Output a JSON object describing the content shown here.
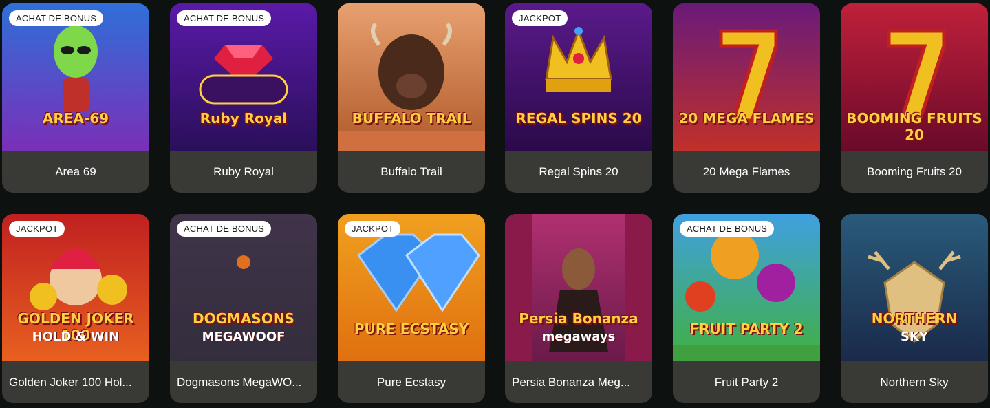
{
  "games": [
    {
      "title": "Area 69",
      "badge": "ACHAT DE BONUS",
      "logo": "AREA-69",
      "icon": "alien-icon",
      "colors": [
        "#2f6fd8",
        "#7a2fb8"
      ]
    },
    {
      "title": "Ruby Royal",
      "badge": "ACHAT DE BONUS",
      "logo": "Ruby Royal",
      "icon": "ruby-gem-icon",
      "colors": [
        "#5a1aa8",
        "#2a0f5a"
      ]
    },
    {
      "title": "Buffalo Trail",
      "badge": "",
      "logo": "BUFFALO TRAIL",
      "icon": "buffalo-icon",
      "colors": [
        "#e8a070",
        "#b05a2a"
      ]
    },
    {
      "title": "Regal Spins 20",
      "badge": "JACKPOT",
      "logo": "REGAL SPINS 20",
      "icon": "crown-icon",
      "colors": [
        "#5a1a8a",
        "#2a0a4a"
      ]
    },
    {
      "title": "20 Mega Flames",
      "badge": "",
      "logo": "20 MEGA FLAMES",
      "icon": "seven-icon",
      "colors": [
        "#6a1a7a",
        "#c0302a"
      ]
    },
    {
      "title": "Booming Fruits 20",
      "badge": "",
      "logo": "BOOMING FRUITS 20",
      "icon": "seven-icon",
      "colors": [
        "#c0203a",
        "#6a0a2a"
      ]
    },
    {
      "title": "Golden Joker 100 Hol...",
      "badge": "JACKPOT",
      "logo": "GOLDEN JOKER 100",
      "logo2": "HOLD & WIN",
      "icon": "joker-icon",
      "colors": [
        "#c02020",
        "#e86020"
      ]
    },
    {
      "title": "Dogmasons MegaWO...",
      "badge": "ACHAT DE BONUS",
      "logo": "DOGMASONS",
      "logo2": "MEGAWOOF",
      "icon": "emblem-icon",
      "colors": [
        "#4a3a5a",
        "#2a2a3a"
      ]
    },
    {
      "title": "Pure Ecstasy",
      "badge": "JACKPOT",
      "logo": "PURE ECSTASY",
      "icon": "diamond-icon",
      "colors": [
        "#f0a020",
        "#e07010"
      ]
    },
    {
      "title": "Persia Bonanza Meg...",
      "badge": "",
      "logo": "Persia Bonanza",
      "logo2": "megaways",
      "icon": "dancer-icon",
      "colors": [
        "#b03070",
        "#6a1a4a"
      ]
    },
    {
      "title": "Fruit Party 2",
      "badge": "ACHAT DE BONUS",
      "logo": "FRUIT PARTY 2",
      "icon": "fruit-icon",
      "colors": [
        "#40a0e0",
        "#40b040"
      ]
    },
    {
      "title": "Northern Sky",
      "badge": "",
      "logo": "NORTHERN",
      "logo2": "SKY",
      "icon": "stag-icon",
      "colors": [
        "#2a5a7a",
        "#1a2a4a"
      ]
    }
  ]
}
